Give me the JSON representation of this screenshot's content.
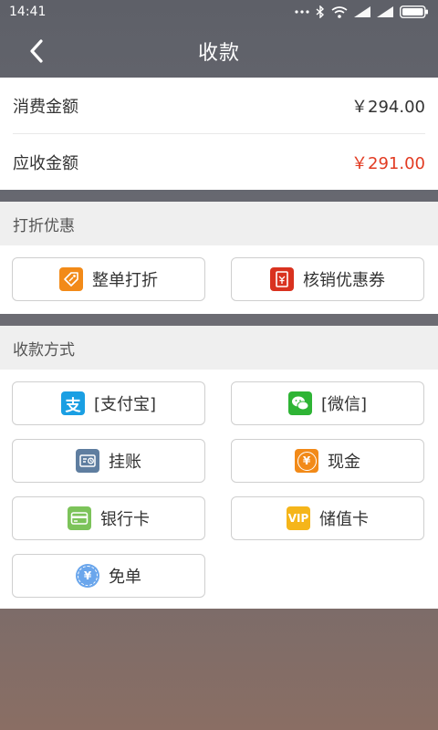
{
  "status_bar": {
    "time": "14:41"
  },
  "header": {
    "title": "收款"
  },
  "amounts": {
    "consume_label": "消费金额",
    "consume_value": "￥294.00",
    "receivable_label": "应收金额",
    "receivable_value": "￥291.00"
  },
  "discount": {
    "heading": "打折优惠",
    "whole_discount": "整单打折",
    "coupon": "核销优惠券"
  },
  "payment": {
    "heading": "收款方式",
    "alipay": "[支付宝]",
    "wechat": "[微信]",
    "credit": "挂账",
    "cash": "现金",
    "bank_card": "银行卡",
    "stored_card": "储值卡",
    "free": "免单"
  },
  "icons": {
    "alipay_glyph": "支",
    "cash_glyph": "¥",
    "vip_glyph": "VIP",
    "free_glyph": "¥"
  },
  "colors": {
    "red_value": "#e23b22",
    "alipay": "#1a9fe3",
    "wechat": "#2eb435",
    "orange": "#f28a18",
    "coupon_red": "#d9321f",
    "credit_slate": "#5f7ea0",
    "bank_green": "#7cc35a",
    "vip_yellow": "#f5b51a",
    "free_blue": "#6aa6ec"
  }
}
